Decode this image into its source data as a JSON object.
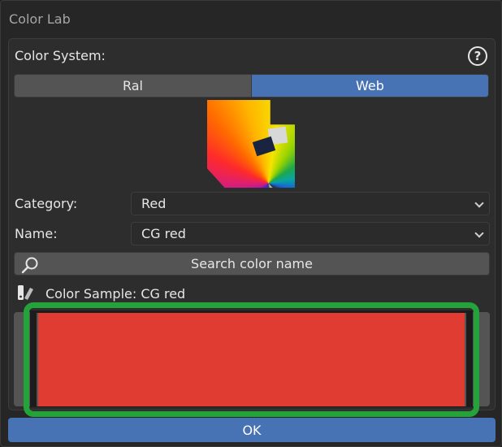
{
  "window": {
    "title": "Color Lab"
  },
  "color_system": {
    "label": "Color System:",
    "options": [
      "Ral",
      "Web"
    ],
    "selected": "Web"
  },
  "category": {
    "label": "Category:",
    "value": "Red"
  },
  "name": {
    "label": "Name:",
    "value": "CG red"
  },
  "search": {
    "label": "Search color name"
  },
  "sample": {
    "label": "Color Sample: CG red",
    "color": "#e03c31"
  },
  "ok_label": "OK",
  "colors": {
    "accent": "#4772b3",
    "highlight": "#23a33a"
  },
  "icons": [
    "help-icon",
    "color-fan-icon",
    "search-icon",
    "palette-icon"
  ]
}
